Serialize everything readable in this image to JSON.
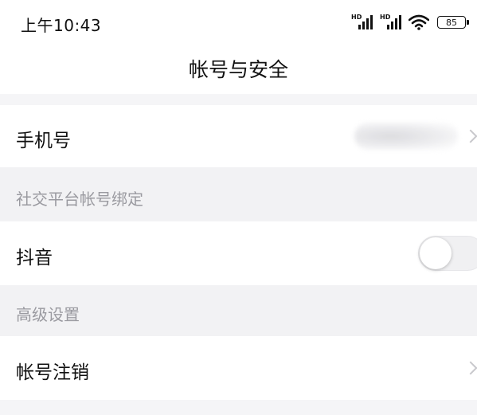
{
  "status_bar": {
    "time": "上午10:43",
    "signal_1_label": "HD",
    "signal_2_label": "HD",
    "battery_level": "85",
    "icons": [
      "hd-signal-icon",
      "hd-signal-icon",
      "wifi-icon",
      "battery-icon"
    ]
  },
  "nav": {
    "title": "帐号与安全"
  },
  "rows": {
    "phone": {
      "label": "手机号",
      "value_blurred": true
    },
    "social_header": {
      "label": "社交平台帐号绑定"
    },
    "douyin": {
      "label": "抖音",
      "toggle_on": false
    },
    "advanced_header": {
      "label": "高级设置"
    },
    "cancel_account": {
      "label": "帐号注销"
    }
  },
  "colors": {
    "background": "#f5f5f7",
    "row_background": "#ffffff",
    "section_text": "#9a9aa0",
    "chevron": "#c8c8cc"
  }
}
